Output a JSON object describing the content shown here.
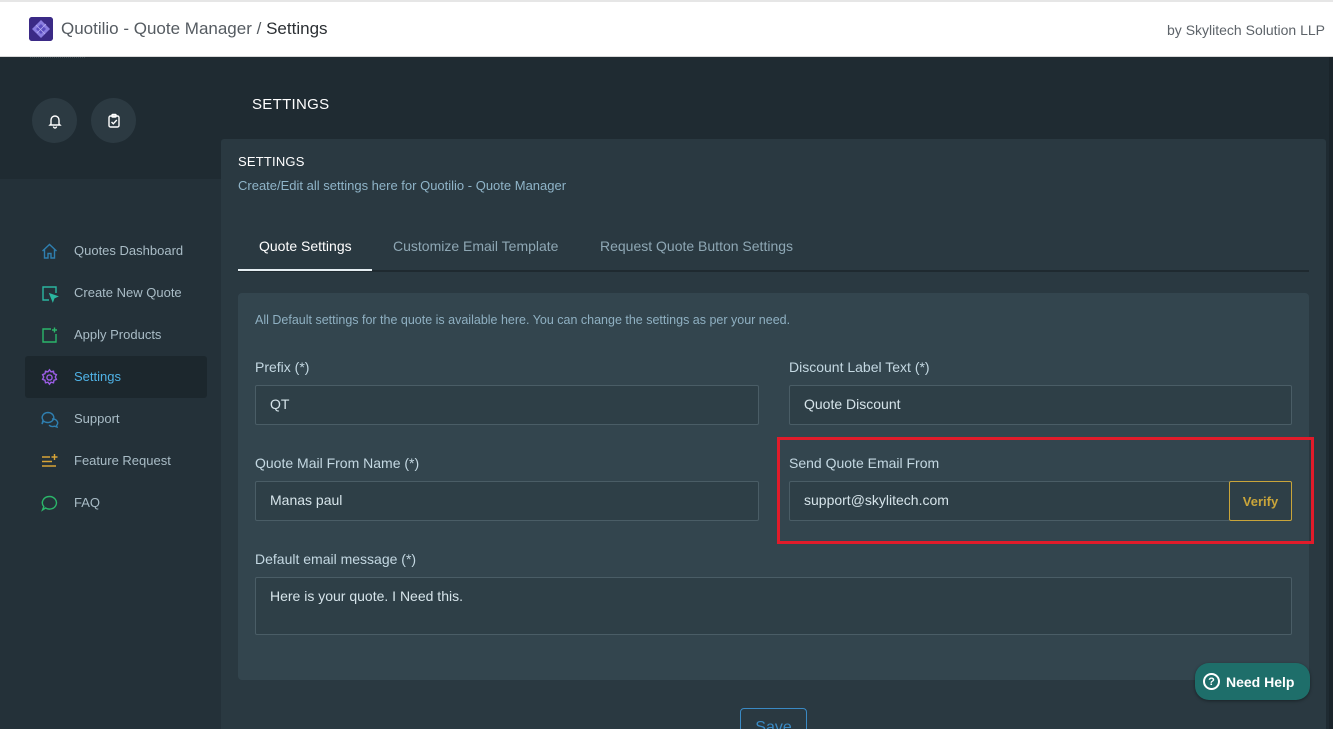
{
  "topbar": {
    "app_name": "Quotilio - Quote Manager",
    "separator": "/",
    "current_page": "Settings",
    "byline": "by Skylitech Solution LLP"
  },
  "header": {
    "title": "SETTINGS",
    "icons": [
      "bell-icon",
      "clipboard-check-icon"
    ]
  },
  "sidebar": {
    "items": [
      {
        "label": "Quotes Dashboard",
        "icon": "home-icon",
        "active": false
      },
      {
        "label": "Create New Quote",
        "icon": "cursor-square-icon",
        "active": false
      },
      {
        "label": "Apply Products",
        "icon": "add-square-icon",
        "active": false
      },
      {
        "label": "Settings",
        "icon": "gear-icon",
        "active": true
      },
      {
        "label": "Support",
        "icon": "chat-bubbles-icon",
        "active": false
      },
      {
        "label": "Feature Request",
        "icon": "list-plus-icon",
        "active": false
      },
      {
        "label": "FAQ",
        "icon": "speech-bubble-icon",
        "active": false
      }
    ]
  },
  "card": {
    "title": "SETTINGS",
    "subtitle": "Create/Edit all settings here for Quotilio - Quote Manager",
    "tabs": [
      {
        "label": "Quote Settings",
        "active": true
      },
      {
        "label": "Customize Email Template",
        "active": false
      },
      {
        "label": "Request Quote Button Settings",
        "active": false
      }
    ],
    "note": "All Default settings for the quote is available here. You can change the settings as per your need."
  },
  "form": {
    "prefix": {
      "label": "Prefix (*)",
      "value": "QT"
    },
    "discount_label": {
      "label": "Discount Label Text (*)",
      "value": "Quote Discount"
    },
    "mail_from_name": {
      "label": "Quote Mail From Name (*)",
      "value": "Manas paul"
    },
    "send_email_from": {
      "label": "Send Quote Email From",
      "value": "support@skylitech.com",
      "verify_label": "Verify"
    },
    "default_message": {
      "label": "Default email message (*)",
      "value": "Here is your quote. I Need this."
    }
  },
  "actions": {
    "save_label": "Save",
    "help_label": "Need Help",
    "help_icon_glyph": "?"
  },
  "colors": {
    "accent_blue": "#4fb2e6",
    "verify_gold": "#c9a53a",
    "highlight_red": "#e11b2a",
    "help_teal": "#1e6e6a"
  }
}
